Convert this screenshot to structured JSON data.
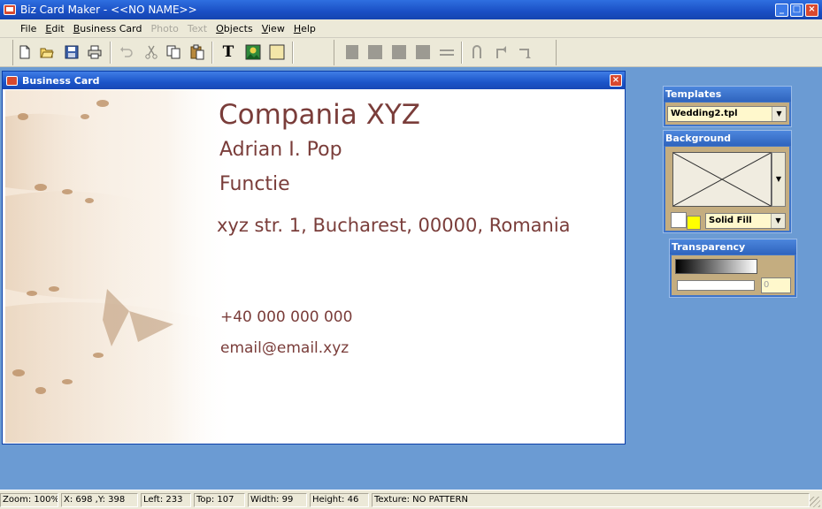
{
  "window": {
    "title": "Biz Card Maker - <<NO NAME>>"
  },
  "menu": [
    {
      "label": "File",
      "disabled": false
    },
    {
      "label": "Edit",
      "disabled": false
    },
    {
      "label": "Business Card",
      "disabled": false
    },
    {
      "label": "Photo",
      "disabled": true
    },
    {
      "label": "Text",
      "disabled": true
    },
    {
      "label": "Objects",
      "disabled": false
    },
    {
      "label": "View",
      "disabled": false
    },
    {
      "label": "Help",
      "disabled": false
    }
  ],
  "toolbar": {
    "icons": [
      "new-document-icon",
      "open-folder-icon",
      "save-icon",
      "print-icon",
      "undo-icon",
      "cut-icon",
      "copy-icon",
      "paste-icon",
      "text-tool-icon",
      "image-tool-icon",
      "rectangle-tool-icon",
      "align-left-icon",
      "align-center-icon",
      "align-right-icon",
      "align-justify-icon",
      "distribute-icon",
      "rotate-icon",
      "rotate-left-icon",
      "rotate-right-icon"
    ],
    "text_tool_glyph": "T"
  },
  "child_window": {
    "title": "Business Card"
  },
  "card": {
    "company": "Compania XYZ",
    "name": "Adrian I. Pop",
    "function": "Functie",
    "address": "xyz str. 1, Bucharest, 00000, Romania",
    "phone": "+40 000 000 000",
    "email": "email@email.xyz",
    "text_color": "#7a3d3a"
  },
  "panels": {
    "templates": {
      "title": "Templates",
      "selected": "Wedding2.tpl"
    },
    "background": {
      "title": "Background",
      "fill_type": "Solid Fill",
      "fill_color": "#ffff00"
    },
    "transparency": {
      "title": "Transparency",
      "value": "0"
    }
  },
  "status": {
    "zoom": "Zoom: 100%",
    "coords": "X: 698 ,Y: 398",
    "left": "Left: 233",
    "top": "Top: 107",
    "width": "Width: 99",
    "height": "Height: 46",
    "texture": "Texture: NO PATTERN"
  }
}
